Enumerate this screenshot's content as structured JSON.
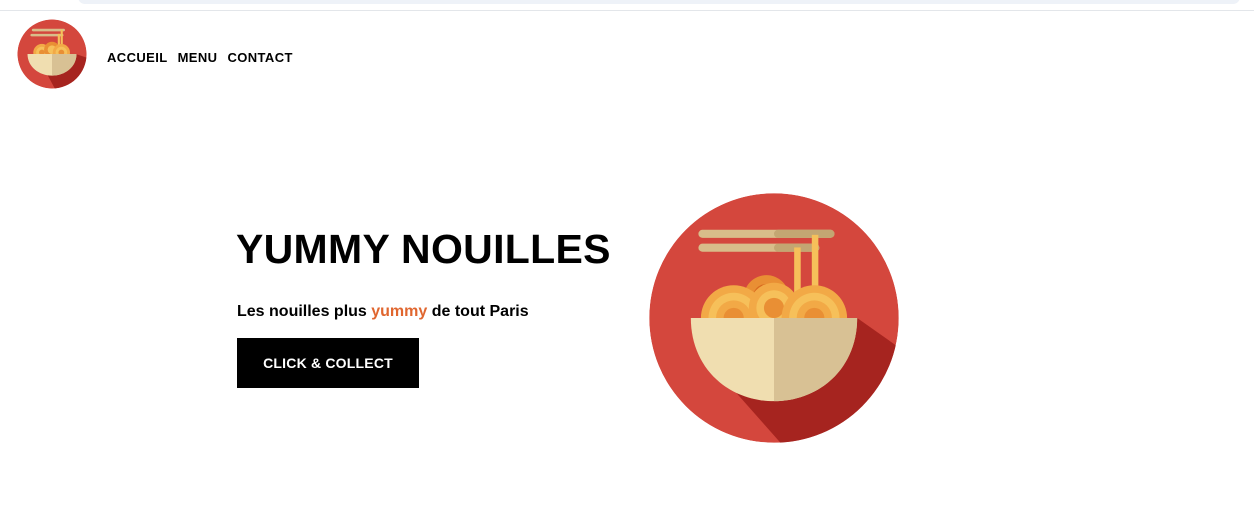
{
  "nav": {
    "items": [
      {
        "label": "ACCUEIL"
      },
      {
        "label": "MENU"
      },
      {
        "label": "CONTACT"
      }
    ]
  },
  "hero": {
    "title": "YUMMY NOUILLES",
    "subtitle_before": "Les nouilles plus ",
    "subtitle_accent": "yummy",
    "subtitle_after": " de tout Paris",
    "cta_label": "CLICK & COLLECT"
  },
  "icons": {
    "logo": "noodle-bowl-icon",
    "hero_image": "noodle-bowl-icon"
  },
  "colors": {
    "brand_red": "#d4473d",
    "accent_orange": "#e0662f",
    "button_bg": "#000000"
  }
}
